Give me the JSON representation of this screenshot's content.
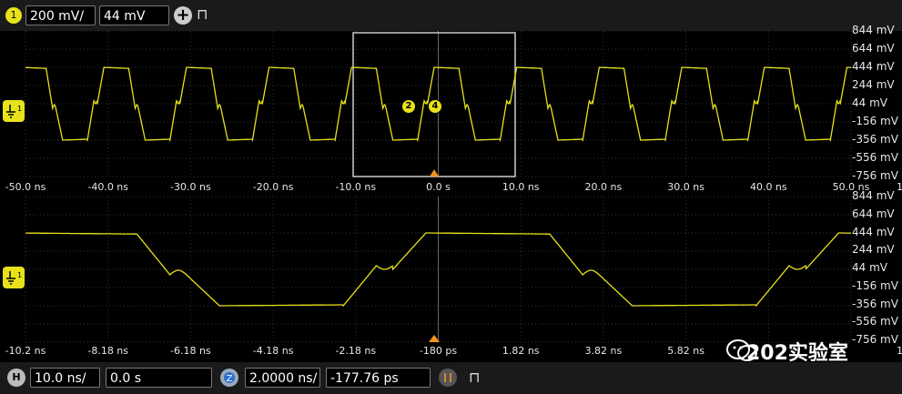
{
  "channel1": {
    "number": "1",
    "scale": "200 mV/",
    "offset": "44 mV",
    "color": "#e7e21a"
  },
  "ymarker": {
    "trace1": "1",
    "trace2": "1"
  },
  "y_labels": [
    "844 mV",
    "644 mV",
    "444 mV",
    "244 mV",
    "44 mV",
    "-156 mV",
    "-356 mV",
    "-556 mV",
    "-756 mV"
  ],
  "x_labels_top": [
    "-50.0 ns",
    "-40.0 ns",
    "-30.0 ns",
    "-20.0 ns",
    "-10.0 ns",
    "0.0 s",
    "10.0 ns",
    "20.0 ns",
    "30.0 ns",
    "40.0 ns",
    "50.0 ns"
  ],
  "x_labels_bottom": [
    "-10.2 ns",
    "-8.18 ns",
    "-6.18 ns",
    "-4.18 ns",
    "-2.18 ns",
    "-180 ps",
    "1.82 ns",
    "3.82 ns",
    "5.82 ns"
  ],
  "end_label": "1",
  "markers": [
    "2",
    "4"
  ],
  "horizontal": {
    "label": "H",
    "scale": "10.0 ns/",
    "position": "0.0 s"
  },
  "zoom": {
    "scale": "2.0000 ns/",
    "position": "-177.76 ps"
  },
  "watermark": "202实验室",
  "chart_data": [
    {
      "type": "line",
      "title": "",
      "x_unit": "ns",
      "x_range": [
        -50,
        50
      ],
      "y_range": [
        -756,
        844
      ],
      "y_unit": "mV",
      "series": [
        {
          "period_ns": 10,
          "high_mv": 444,
          "low_mv": -356,
          "phase_ns": -2.5
        }
      ]
    },
    {
      "type": "line",
      "title": "",
      "x_unit": "ns",
      "x_range": [
        -10.2,
        9.8
      ],
      "y_range": [
        -756,
        844
      ],
      "y_unit": "mV",
      "series": [
        {
          "period_ns": 10,
          "high_mv": 444,
          "low_mv": -356,
          "phase_ns": -2.5
        }
      ]
    }
  ]
}
